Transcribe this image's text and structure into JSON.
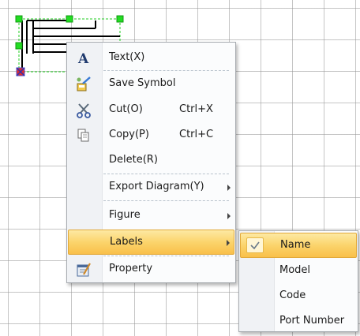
{
  "context_menu": {
    "items": [
      {
        "label": "Text(X)",
        "icon": "text-A-icon"
      },
      {
        "label": "Save Symbol",
        "icon": "save-symbol-icon"
      },
      {
        "label": "Cut(O)",
        "shortcut": "Ctrl+X",
        "icon": "scissors-icon"
      },
      {
        "label": "Copy(P)",
        "shortcut": "Ctrl+C",
        "icon": "copy-icon"
      },
      {
        "label": "Delete(R)"
      },
      {
        "label": "Export Diagram(Y)",
        "submenu": true
      },
      {
        "label": "Figure",
        "submenu": true
      },
      {
        "label": "Labels",
        "submenu": true,
        "highlighted": true
      },
      {
        "label": "Property",
        "icon": "property-icon"
      }
    ]
  },
  "labels_submenu": {
    "items": [
      {
        "label": "Name",
        "checked": true,
        "highlighted": true
      },
      {
        "label": "Model"
      },
      {
        "label": "Code"
      },
      {
        "label": "Port Number"
      }
    ]
  },
  "colors": {
    "highlight": "#fbd46c",
    "selection_handle": "#22cc22",
    "grid": "#969696"
  }
}
